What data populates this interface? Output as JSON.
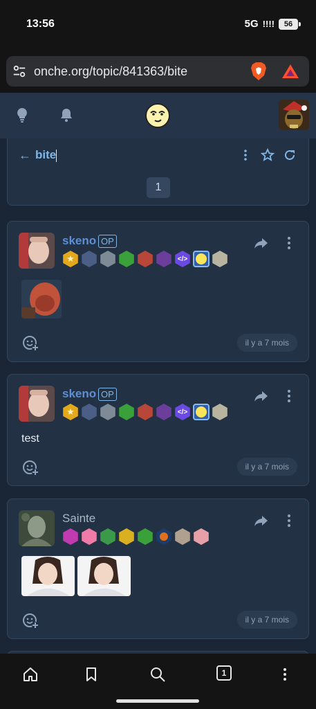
{
  "status_bar": {
    "time": "13:56",
    "network": "5G",
    "signal": "!!!!",
    "battery": "56"
  },
  "browser": {
    "url": "onche.org/topic/841363/bite"
  },
  "header": {
    "idea_icon": "lightbulb-icon",
    "notif_icon": "bell-icon",
    "logo_icon": "smiley-logo-icon"
  },
  "topic": {
    "title": "bite",
    "page": "1"
  },
  "posts": [
    {
      "author": "skeno",
      "op": "OP",
      "body": "",
      "time": "il y a 7 mois"
    },
    {
      "author": "skeno",
      "op": "OP",
      "body": "test",
      "time": "il y a 7 mois"
    },
    {
      "author": "Sainte",
      "op": "",
      "body": "",
      "time": "il y a 7 mois"
    }
  ],
  "bottom_nav": {
    "tabs_count": "1"
  },
  "colors": {
    "accent": "#7fb7e8",
    "background": "#1a2535",
    "card": "#233144"
  }
}
